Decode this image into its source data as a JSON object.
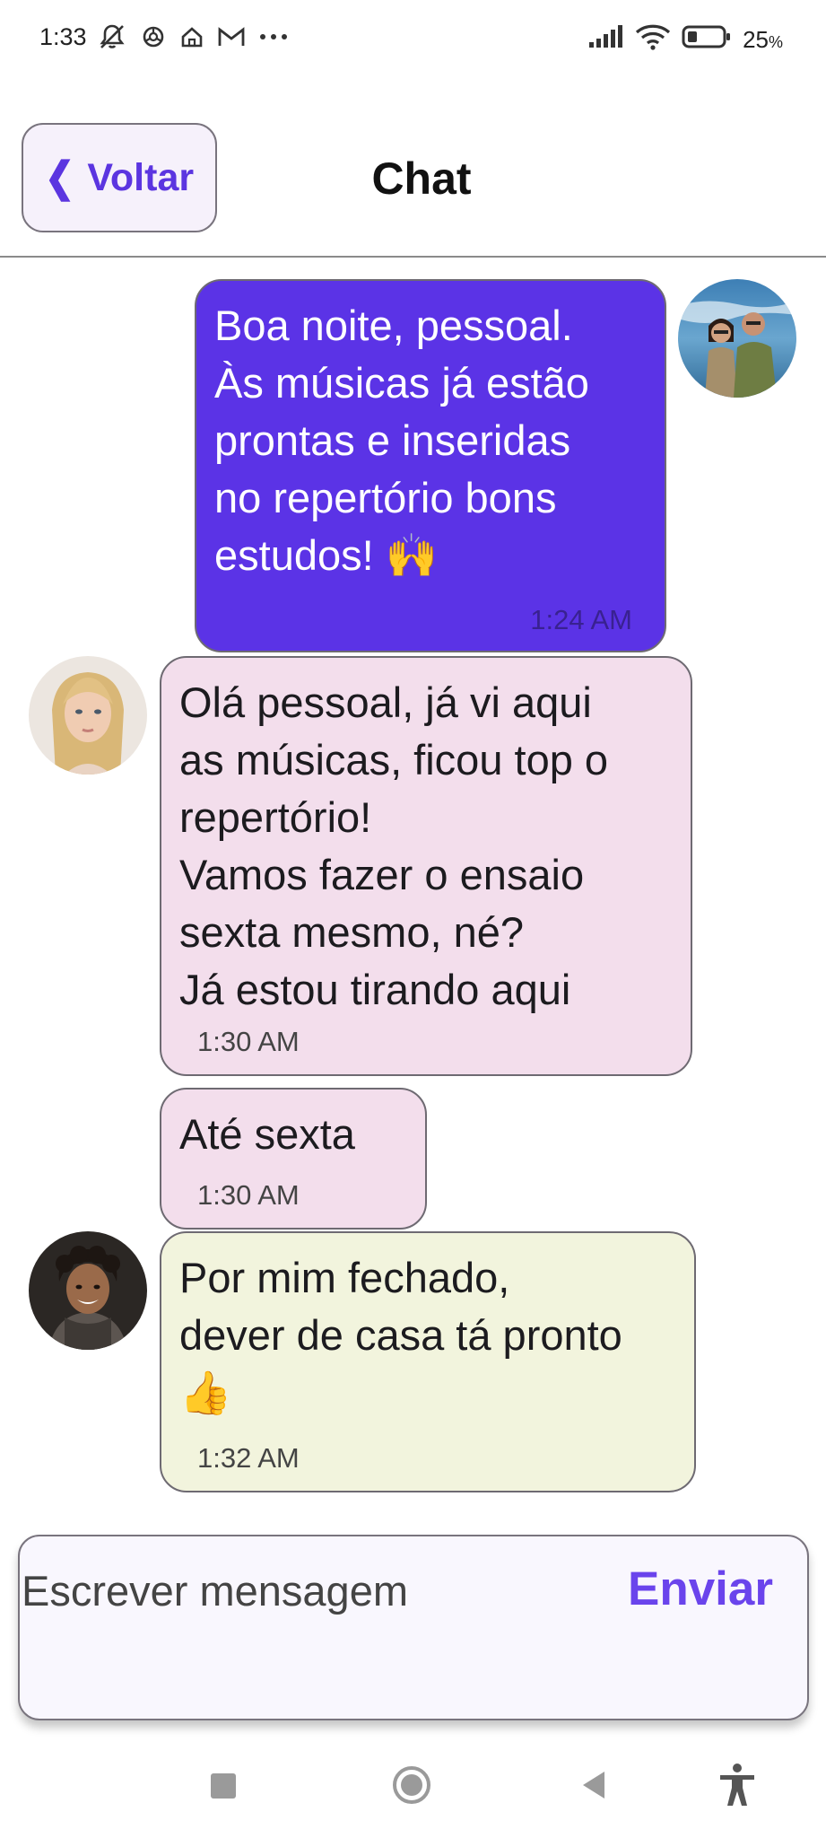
{
  "status_bar": {
    "time": "1:33",
    "battery": "25",
    "battery_unit": "%",
    "left_icons": [
      "notifications-off-icon",
      "openai-icon",
      "home-icon",
      "gmail-icon",
      "more-dots-icon"
    ],
    "right_icons": [
      "signal-icon",
      "wifi-icon",
      "battery-icon"
    ]
  },
  "header": {
    "back_label": "Voltar",
    "title": "Chat"
  },
  "messages": [
    {
      "id": "m1",
      "side": "right",
      "text": "Boa noite, pessoal.\nÀs músicas já estão\nprontas e inseridas\nno repertório bons\nestudos! 🙌",
      "time": "1:24 AM",
      "color": "#5b33e6"
    },
    {
      "id": "m2",
      "side": "left",
      "text": "Olá pessoal, já vi aqui\nas músicas, ficou top o\nrepertório!\nVamos fazer o ensaio\nsexta mesmo, né?\nJá estou tirando aqui",
      "time": "1:30 AM",
      "color": "#f3deec"
    },
    {
      "id": "m3",
      "side": "left",
      "text": "Até sexta",
      "time": "1:30 AM",
      "color": "#f3deec"
    },
    {
      "id": "m4",
      "side": "left",
      "text": "Por mim fechado,\ndever de casa tá pronto\n👍",
      "time": "1:32 AM",
      "color": "#f2f4dd"
    }
  ],
  "composer": {
    "placeholder": "Escrever mensagem",
    "value": "",
    "send_label": "Enviar"
  },
  "nav_bar": {
    "items": [
      "recents-icon",
      "home-icon",
      "back-icon",
      "accessibility-icon"
    ]
  },
  "colors": {
    "accent": "#5b35e0",
    "sent_bubble": "#5b33e6",
    "received_bubble_pink": "#f3deec",
    "received_bubble_green": "#f2f4dd"
  }
}
